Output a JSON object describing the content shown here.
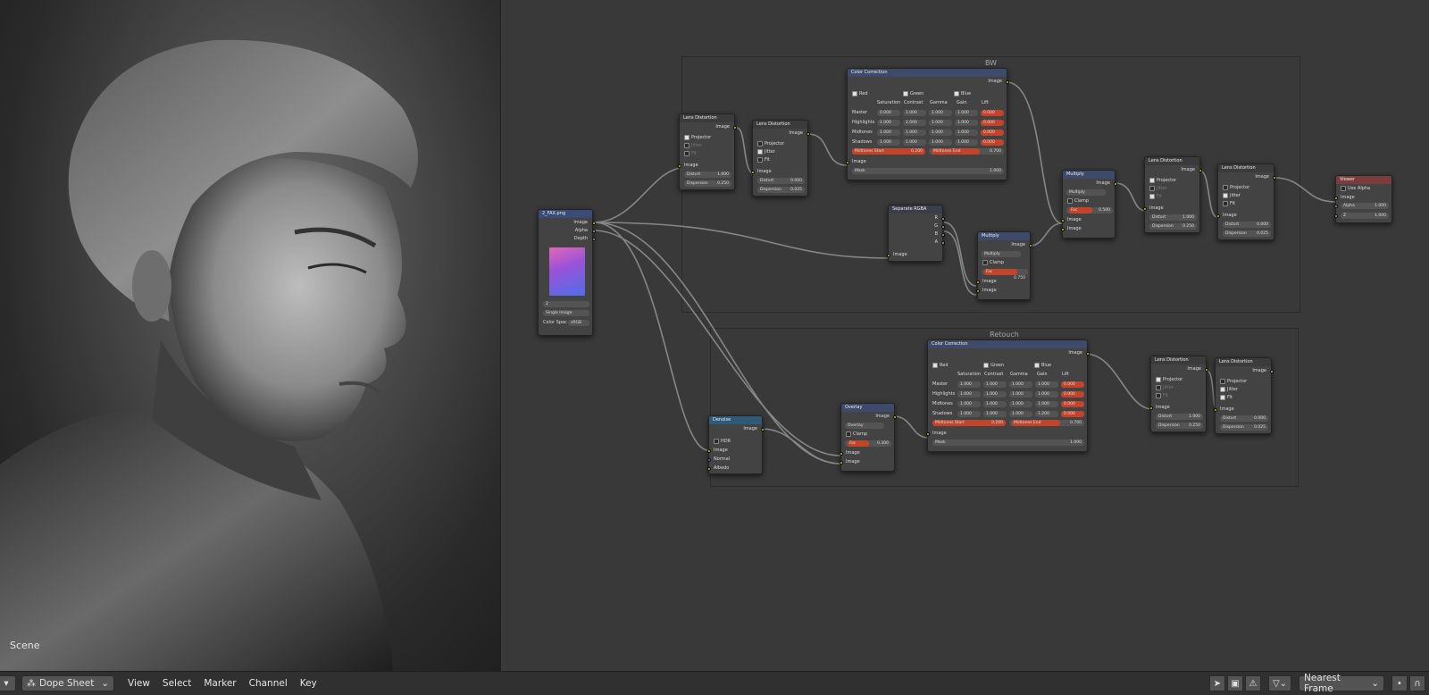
{
  "viewer": {
    "scene_label": "Scene"
  },
  "frames": {
    "bw": "BW",
    "retouch": "Retouch"
  },
  "nodes": {
    "image_input": {
      "title": "2_FAX.png",
      "outputs": [
        "Image",
        "Alpha",
        "Depth"
      ],
      "frame_value": "2",
      "source": "Single Image",
      "color_space_label": "Color Spac",
      "color_space": "sRGB"
    },
    "lens1": {
      "title": "Lens Distortion",
      "out": "Image",
      "projector": "Projector",
      "jitter": "Jitter",
      "fit": "Fit",
      "in": "Image",
      "distort_label": "Distort",
      "distort": "1.000",
      "dispersion_label": "Dispersion",
      "dispersion": "0.250"
    },
    "lens2": {
      "title": "Lens Distortion",
      "out": "Image",
      "projector": "Projector",
      "jitter": "Jitter",
      "fit": "Fit",
      "in": "Image",
      "distort_label": "Distort",
      "distort": "0.000",
      "dispersion_label": "Dispersion",
      "dispersion": "0.025"
    },
    "cc1": {
      "title": "Color Correction",
      "out": "Image",
      "channels": [
        "Red",
        "Green",
        "Blue"
      ],
      "cols": [
        "Saturation",
        "Contrast",
        "Gamma",
        "Gain",
        "Lift"
      ],
      "rows": [
        {
          "label": "Master",
          "vals": [
            "0.000",
            "1.000",
            "1.000",
            "1.000",
            "0.000"
          ]
        },
        {
          "label": "Highlights",
          "vals": [
            "1.000",
            "1.000",
            "1.000",
            "1.000",
            "0.000"
          ]
        },
        {
          "label": "Midtones",
          "vals": [
            "1.000",
            "1.000",
            "1.000",
            "1.000",
            "0.000"
          ]
        },
        {
          "label": "Shadows",
          "vals": [
            "1.000",
            "1.000",
            "1.000",
            "1.000",
            "0.000"
          ]
        }
      ],
      "mid_start_label": "Midtones Start",
      "mid_start": "0.200",
      "mid_end_label": "Midtones End",
      "mid_end": "0.700",
      "in": "Image",
      "mask_label": "Mask",
      "mask": "1.000"
    },
    "sep": {
      "title": "Separate RGBA",
      "outputs": [
        "R",
        "G",
        "B",
        "A"
      ],
      "in": "Image"
    },
    "mult1": {
      "title": "Multiply",
      "out": "Image",
      "mode": "Multiply",
      "clamp": "Clamp",
      "fac_label": "Fac",
      "fac": "0.750",
      "in1": "Image",
      "in2": "Image"
    },
    "mult2": {
      "title": "Multiply",
      "out": "Image",
      "mode": "Multiply",
      "clamp": "Clamp",
      "fac_label": "Fac",
      "fac": "0.500",
      "in1": "Image",
      "in2": "Image"
    },
    "lens3": {
      "title": "Lens Distortion",
      "out": "Image",
      "projector": "Projector",
      "jitter": "Jitter",
      "fit": "Fit",
      "in": "Image",
      "distort_label": "Distort",
      "distort": "1.000",
      "dispersion_label": "Dispersion",
      "dispersion": "0.250"
    },
    "lens4": {
      "title": "Lens Distortion",
      "out": "Image",
      "projector": "Projector",
      "jitter": "Jitter",
      "fit": "Fit",
      "in": "Image",
      "distort_label": "Distort",
      "distort": "0.000",
      "dispersion_label": "Dispersion",
      "dispersion": "0.025"
    },
    "viewer": {
      "title": "Viewer",
      "use_alpha": "Use Alpha",
      "in": "Image",
      "alpha_label": "Alpha",
      "alpha": "1.000",
      "z_label": "Z",
      "z": "1.000"
    },
    "denoise": {
      "title": "Denoise",
      "out": "Image",
      "hdr": "HDR",
      "inputs": [
        "Image",
        "Normal",
        "Albedo"
      ]
    },
    "overlay": {
      "title": "Overlay",
      "out": "Image",
      "mode": "Overlay",
      "clamp": "Clamp",
      "fac_label": "Fac",
      "fac": "0.300",
      "in1": "Image",
      "in2": "Image"
    },
    "cc2": {
      "title": "Color Correction",
      "out": "Image",
      "channels": [
        "Red",
        "Green",
        "Blue"
      ],
      "cols": [
        "Saturation",
        "Contrast",
        "Gamma",
        "Gain",
        "Lift"
      ],
      "rows": [
        {
          "label": "Master",
          "vals": [
            "1.000",
            "1.000",
            "1.000",
            "1.000",
            "0.000"
          ]
        },
        {
          "label": "Highlights",
          "vals": [
            "1.000",
            "1.000",
            "1.000",
            "1.000",
            "0.000"
          ]
        },
        {
          "label": "Midtones",
          "vals": [
            "1.000",
            "1.000",
            "1.000",
            "1.000",
            "0.000"
          ]
        },
        {
          "label": "Shadows",
          "vals": [
            "1.000",
            "1.000",
            "1.000",
            "1.200",
            "0.000"
          ]
        }
      ],
      "mid_start_label": "Midtones Start",
      "mid_start": "0.200",
      "mid_end_label": "Midtones End",
      "mid_end": "0.700",
      "in": "Image",
      "mask_label": "Mask",
      "mask": "1.000"
    },
    "lens5": {
      "title": "Lens Distortion",
      "out": "Image",
      "projector": "Projector",
      "jitter": "Jitter",
      "fit": "Fit",
      "in": "Image",
      "distort_label": "Distort",
      "distort": "1.000",
      "dispersion_label": "Dispersion",
      "dispersion": "0.250"
    },
    "lens6": {
      "title": "Lens Distortion",
      "out": "Image",
      "projector": "Projector",
      "jitter": "Jitter",
      "fit": "Fit",
      "in": "Image",
      "distort_label": "Distort",
      "distort": "0.000",
      "dispersion_label": "Dispersion",
      "dispersion": "0.025"
    }
  },
  "footer": {
    "editor_type": "Dope Sheet",
    "menus": [
      "View",
      "Select",
      "Marker",
      "Channel",
      "Key"
    ],
    "snap_mode": "Nearest Frame"
  },
  "colors": {
    "accent_red": "#e05828",
    "socket_yellow": "#c7c729",
    "bg": "#393939"
  }
}
